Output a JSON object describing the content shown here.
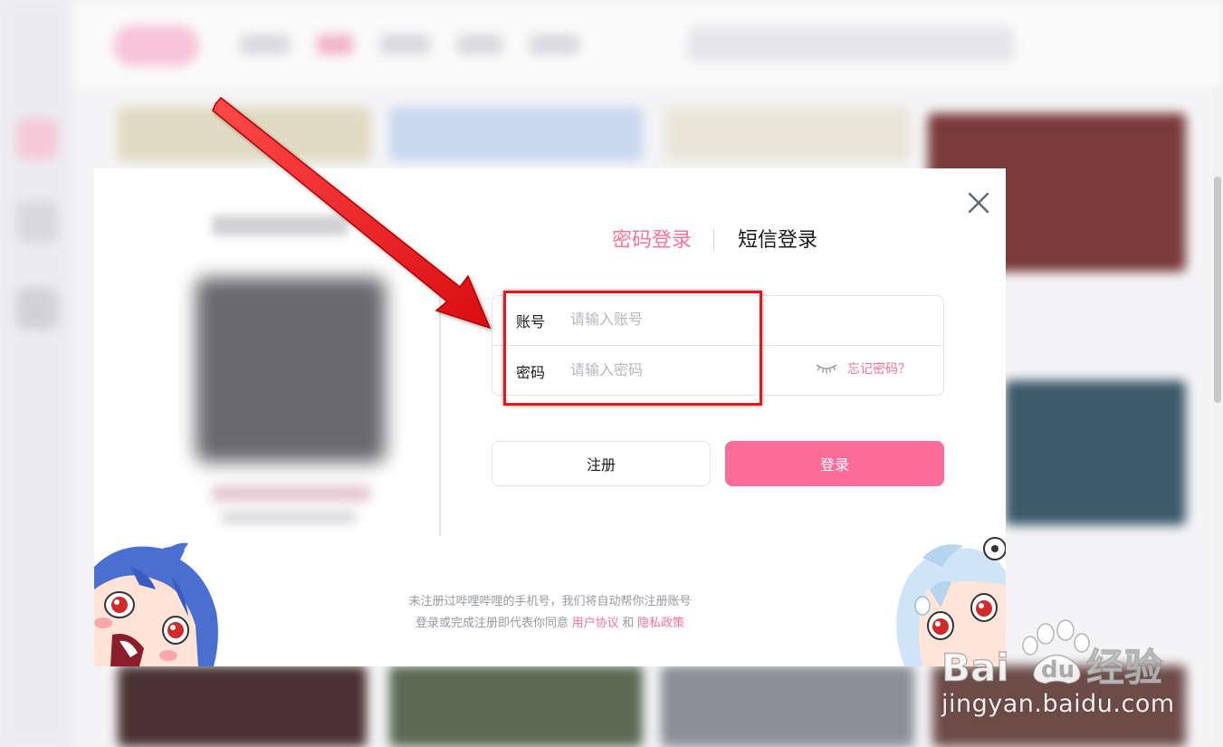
{
  "login_modal": {
    "tabs": [
      {
        "label": "密码登录",
        "active": true
      },
      {
        "label": "短信登录",
        "active": false
      }
    ],
    "account_label": "账号",
    "account_placeholder": "请输入账号",
    "password_label": "密码",
    "password_placeholder": "请输入密码",
    "forgot_password": "忘记密码？",
    "register_button": "注册",
    "login_button": "登录",
    "footer_line1": "未注册过哔哩哔哩的手机号，我们将自动帮你注册账号",
    "footer_line2_prefix": "登录或完成注册即代表你同意",
    "user_agreement": "用户协议",
    "and": "和",
    "privacy_policy": "隐私政策"
  },
  "watermark": {
    "logo_text": "Bai du 经验",
    "domain": "jingyan.baidu.com"
  },
  "colors": {
    "accent": "#fb7299",
    "login_button": "#fc6c9a",
    "highlight": "#e0191f"
  },
  "icons": [
    "close-icon",
    "eye-closed-icon",
    "red-arrow"
  ]
}
